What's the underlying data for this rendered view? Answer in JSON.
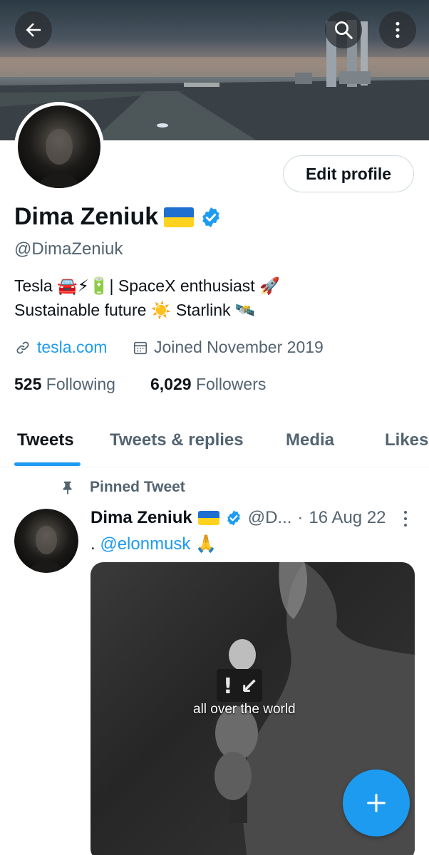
{
  "header": {
    "back_icon": "arrow-left-icon",
    "search_icon": "search-icon",
    "more_icon": "more-vertical-icon"
  },
  "profile": {
    "name": "Dima Zeniuk",
    "handle": "@DimaZeniuk",
    "edit_label": "Edit profile",
    "bio_line1": "Tesla 🚘⚡🔋| SpaceX enthusiast 🚀",
    "bio_line2": "Sustainable future ☀️ Starlink 🛰️",
    "website": "tesla.com",
    "joined": "Joined November 2019",
    "following_count": "525",
    "following_label": "Following",
    "followers_count": "6,029",
    "followers_label": "Followers"
  },
  "tabs": [
    {
      "label": "Tweets",
      "active": true
    },
    {
      "label": "Tweets & replies",
      "active": false
    },
    {
      "label": "Media",
      "active": false
    },
    {
      "label": "Likes",
      "active": false
    }
  ],
  "tweet": {
    "pinned_label": "Pinned Tweet",
    "author": "Dima Zeniuk",
    "handle": "@D...",
    "separator": "·",
    "date": "16 Aug 22",
    "text_prefix": ". ",
    "mention": "@elonmusk",
    "text_suffix": " 🙏",
    "media_caption": "all over the world"
  },
  "colors": {
    "accent": "#1d9bf0",
    "text_primary": "#0f1419",
    "text_secondary": "#536471"
  }
}
